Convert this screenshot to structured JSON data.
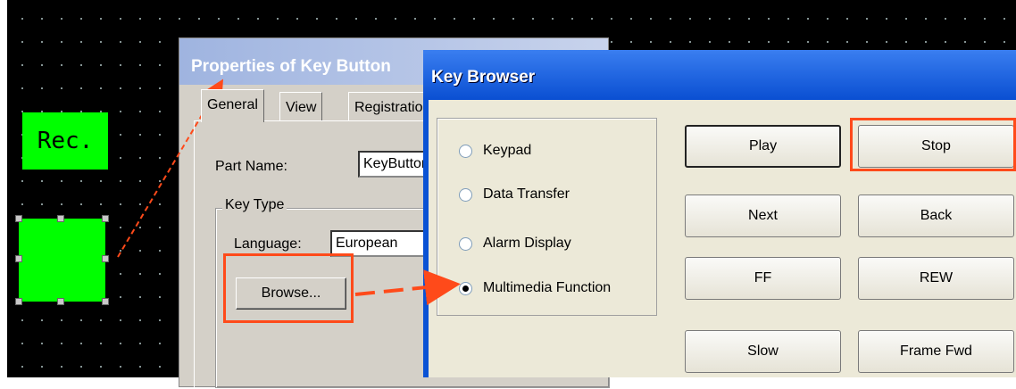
{
  "canvas": {
    "rec_label": "Rec."
  },
  "properties_dialog": {
    "title": "Properties of Key Button",
    "tabs": [
      "General",
      "View",
      "Registration"
    ],
    "part_name_label": "Part Name:",
    "part_name_value": "KeyButton",
    "key_type_label": "Key Type",
    "language_label": "Language:",
    "language_value": "European",
    "browse_label": "Browse..."
  },
  "key_browser": {
    "title": "Key Browser",
    "radio_options": [
      {
        "label": "Keypad",
        "selected": false
      },
      {
        "label": "Data Transfer",
        "selected": false
      },
      {
        "label": "Alarm Display",
        "selected": false
      },
      {
        "label": "Multimedia Function",
        "selected": true
      }
    ],
    "keys": [
      "Play",
      "Stop",
      "Next",
      "Back",
      "FF",
      "REW",
      "Slow",
      "Frame Fwd"
    ]
  },
  "colors": {
    "highlight": "#ff4a1a",
    "green": "#00ff00",
    "title_blue": "#0a52d4"
  }
}
